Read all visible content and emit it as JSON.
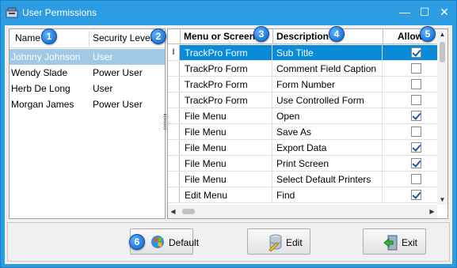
{
  "window": {
    "title": "User Permissions",
    "minimize_glyph": "—",
    "maximize_glyph": "☐",
    "close_glyph": "✕"
  },
  "users": {
    "columns": {
      "name": "Name",
      "security": "Security Level"
    },
    "rows": [
      {
        "name": "Johnny Johnson",
        "level": "User",
        "selected": true
      },
      {
        "name": "Wendy Slade",
        "level": "Power User"
      },
      {
        "name": "Herb De Long",
        "level": "User"
      },
      {
        "name": "Morgan James",
        "level": "Power User"
      }
    ]
  },
  "grid": {
    "columns": {
      "menu": "Menu or Screen",
      "description": "Description",
      "allow": "Allow"
    },
    "row_indicator": "I",
    "rows": [
      {
        "menu": "TrackPro Form",
        "description": "Sub Title",
        "allow": true,
        "selected": true
      },
      {
        "menu": "TrackPro Form",
        "description": "Comment Field Caption",
        "allow": false
      },
      {
        "menu": "TrackPro Form",
        "description": "Form Number",
        "allow": false
      },
      {
        "menu": "TrackPro Form",
        "description": "Use Controlled Form",
        "allow": false
      },
      {
        "menu": "File Menu",
        "description": "Open",
        "allow": true
      },
      {
        "menu": "File Menu",
        "description": "Save As",
        "allow": false
      },
      {
        "menu": "File Menu",
        "description": "Export Data",
        "allow": true
      },
      {
        "menu": "File Menu",
        "description": "Print Screen",
        "allow": true
      },
      {
        "menu": "File Menu",
        "description": "Select Default Printers",
        "allow": false
      },
      {
        "menu": "Edit Menu",
        "description": "Find",
        "allow": true
      }
    ]
  },
  "buttons": {
    "default": "Default",
    "edit": "Edit",
    "exit": "Exit"
  },
  "badges": [
    "1",
    "2",
    "3",
    "4",
    "5",
    "6"
  ],
  "colors": {
    "titlebar": "#2d9de3",
    "selection": "#0a8ad8",
    "inactive_selection": "#9fc9e6"
  }
}
